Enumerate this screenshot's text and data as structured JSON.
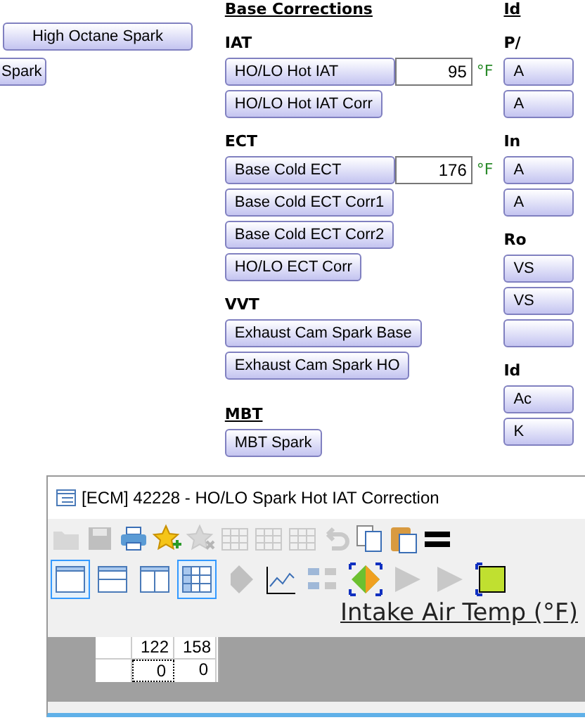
{
  "left_column": {
    "buttons": [
      "High Octane Spark",
      "Spark"
    ]
  },
  "base_corrections": {
    "heading": "Base Corrections",
    "groups": [
      {
        "label": "IAT",
        "underlined": false,
        "items": [
          {
            "kind": "field",
            "label": "HO/LO Hot IAT",
            "value": "95",
            "unit": "°F"
          },
          {
            "kind": "button",
            "label": "HO/LO Hot IAT Corr"
          }
        ]
      },
      {
        "label": "ECT",
        "underlined": false,
        "items": [
          {
            "kind": "field",
            "label": "Base Cold ECT",
            "value": "176",
            "unit": "°F"
          },
          {
            "kind": "button",
            "label": "Base Cold ECT Corr1"
          },
          {
            "kind": "button",
            "label": "Base Cold ECT Corr2"
          },
          {
            "kind": "button",
            "label": "HO/LO ECT Corr"
          }
        ]
      },
      {
        "label": "VVT",
        "underlined": false,
        "items": [
          {
            "kind": "button",
            "label": "Exhaust Cam Spark Base"
          },
          {
            "kind": "button",
            "label": "Exhaust Cam Spark HO"
          }
        ]
      },
      {
        "label": "MBT",
        "underlined": true,
        "items": [
          {
            "kind": "button",
            "label": "MBT Spark"
          }
        ]
      }
    ]
  },
  "right_column": {
    "heading": "Id",
    "groups": [
      {
        "label": "P/",
        "items": [
          {
            "kind": "button",
            "label": "A"
          },
          {
            "kind": "button",
            "label": "A"
          }
        ]
      },
      {
        "label": "In",
        "items": [
          {
            "kind": "button",
            "label": "A"
          },
          {
            "kind": "button",
            "label": "A"
          }
        ]
      },
      {
        "label": "Ro",
        "items": [
          {
            "kind": "button",
            "label": "VS"
          },
          {
            "kind": "button",
            "label": "VS"
          },
          {
            "kind": "blank"
          }
        ]
      },
      {
        "label": "Id",
        "items": [
          {
            "kind": "button",
            "label": "Ac"
          },
          {
            "kind": "button",
            "label": "K"
          }
        ]
      }
    ]
  },
  "window": {
    "title": "[ECM] 42228 - HO/LO Spark Hot IAT Correction",
    "toolbar_1": [
      {
        "kind": "open",
        "disabled": true
      },
      {
        "kind": "save",
        "disabled": true
      },
      {
        "kind": "print",
        "disabled": false
      },
      {
        "kind": "star-add",
        "disabled": false
      },
      {
        "kind": "star-remove",
        "disabled": true
      },
      {
        "kind": "grid",
        "disabled": true
      },
      {
        "kind": "grid",
        "disabled": true
      },
      {
        "kind": "grid",
        "disabled": true
      },
      {
        "kind": "undo",
        "disabled": true
      },
      {
        "kind": "copy",
        "disabled": false
      },
      {
        "kind": "paste",
        "disabled": false
      },
      {
        "kind": "equals",
        "disabled": false
      }
    ],
    "toolbar_2": [
      {
        "kind": "layout-single",
        "selected": true
      },
      {
        "kind": "layout-rows",
        "selected": false
      },
      {
        "kind": "layout-cols",
        "selected": false
      },
      {
        "kind": "table",
        "selected": true
      },
      {
        "kind": "diamond",
        "selected": false
      },
      {
        "kind": "line-chart",
        "selected": false
      },
      {
        "kind": "decimals",
        "selected": false
      },
      {
        "kind": "color-diamond",
        "selected": false
      },
      {
        "kind": "shape",
        "selected": false
      },
      {
        "kind": "shape",
        "selected": false
      },
      {
        "kind": "marker",
        "selected": false
      }
    ],
    "axis_label": "Intake Air Temp (°F)",
    "table": {
      "columns": [
        "122",
        "158"
      ],
      "rows": [
        {
          "cells": [
            {
              "value": "0",
              "selected": true
            },
            {
              "value": "0",
              "selected": false
            }
          ]
        }
      ]
    }
  }
}
